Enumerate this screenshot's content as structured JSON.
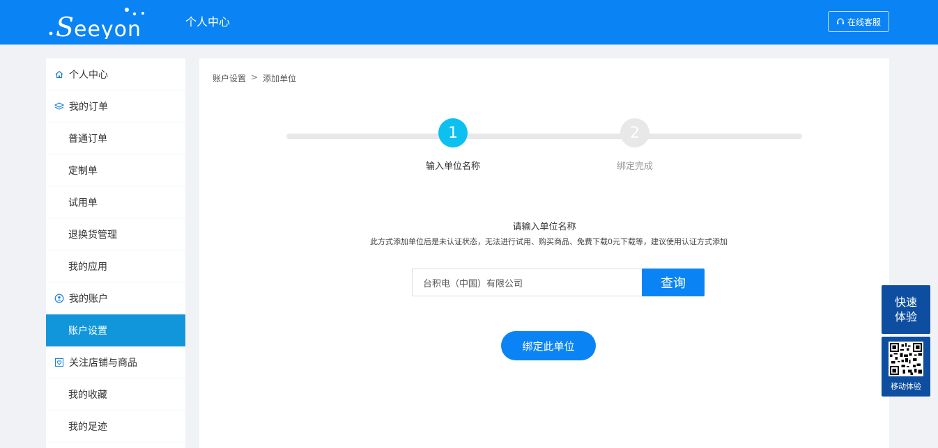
{
  "header": {
    "logo_text": "Seeyon",
    "title": "个人中心",
    "service_label": "在线客服"
  },
  "sidebar": {
    "items": [
      {
        "label": "个人中心",
        "icon": "home-icon",
        "group": true
      },
      {
        "label": "我的订单",
        "icon": "layers-icon",
        "group": true
      },
      {
        "label": "普通订单"
      },
      {
        "label": "定制单"
      },
      {
        "label": "试用单"
      },
      {
        "label": "退换货管理"
      },
      {
        "label": "我的应用"
      },
      {
        "label": "我的账户",
        "icon": "account-icon",
        "group": true
      },
      {
        "label": "账户设置",
        "active": true
      },
      {
        "label": "关注店铺与商品",
        "icon": "heart-icon",
        "group": true
      },
      {
        "label": "我的收藏"
      },
      {
        "label": "我的足迹"
      }
    ]
  },
  "breadcrumb": {
    "parent": "账户设置",
    "separator": ">",
    "current": "添加单位"
  },
  "steps": [
    {
      "number": "1",
      "label": "输入单位名称",
      "active": true
    },
    {
      "number": "2",
      "label": "绑定完成",
      "active": false
    }
  ],
  "form": {
    "title": "请输入单位名称",
    "note": "此方式添加单位后是未认证状态，无法进行试用、购买商品、免费下载0元下载等，建议使用认证方式添加",
    "input_value": "台积电（中国）有限公司",
    "search_label": "查询",
    "bind_label": "绑定此单位"
  },
  "floating": {
    "quick_line1": "快速",
    "quick_line2": "体验",
    "mobile_label": "移动体验"
  },
  "colors": {
    "brand": "#0a84f5",
    "active_sidebar": "#1296db",
    "step_active": "#0cc0f0",
    "float_bg": "#0d4ea0"
  }
}
